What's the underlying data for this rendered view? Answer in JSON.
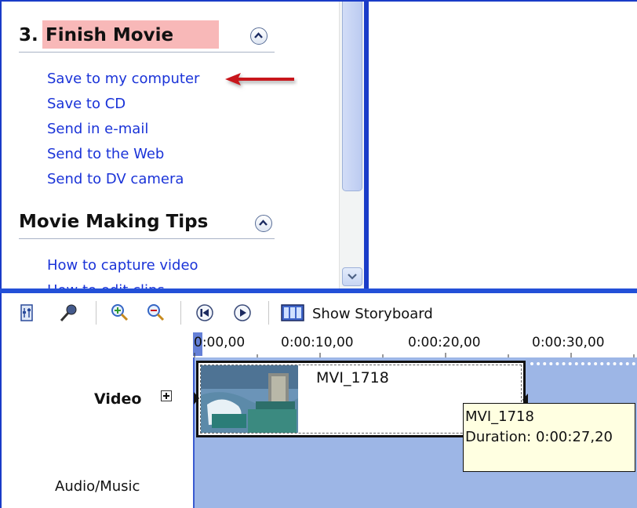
{
  "tasks": {
    "finish_number": "3.",
    "finish_title": "Finish Movie",
    "finish_links": [
      "Save to my computer",
      "Save to CD",
      "Send in e-mail",
      "Send to the Web",
      "Send to DV camera"
    ],
    "tips_title": "Movie Making Tips",
    "tips_links": [
      "How to capture video",
      "How to edit clips"
    ]
  },
  "toolbar": {
    "show_storyboard_label": "Show Storyboard"
  },
  "timeline": {
    "ruler_ticks": [
      "0:00,00",
      "0:00:10,00",
      "0:00:20,00",
      "0:00:30,00"
    ],
    "video_label": "Video",
    "audio_label": "Audio/Music",
    "clip_name": "MVI_1718"
  },
  "tooltip": {
    "name": "MVI_1718",
    "duration": "Duration:  0:00:27,20"
  },
  "colors": {
    "link": "#1a33d8",
    "highlight": "#f8b8b8",
    "annotation_arrow": "#c8141e",
    "frame_blue": "#1a3cc8",
    "track_blue": "#9db6e6",
    "tooltip_bg": "#ffffe1"
  }
}
